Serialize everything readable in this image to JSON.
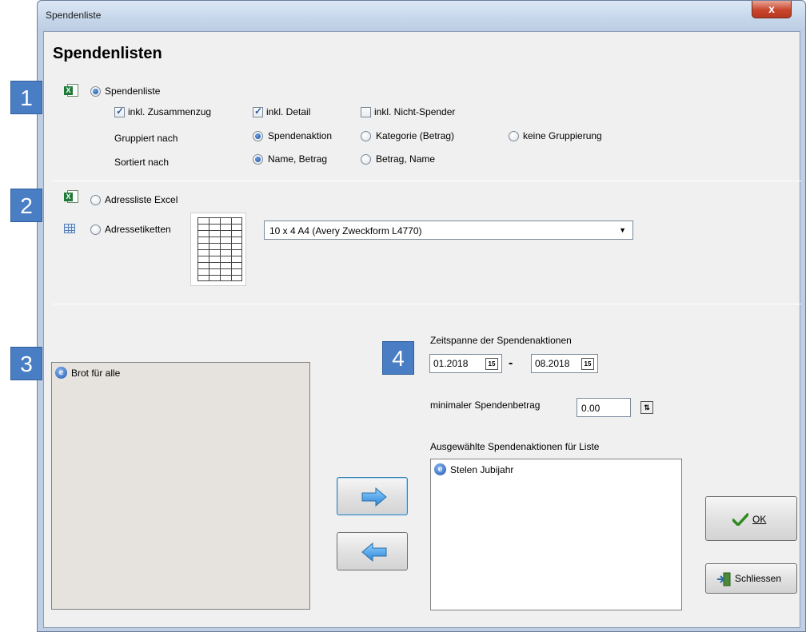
{
  "window": {
    "title": "Spendenliste",
    "close_glyph": "x"
  },
  "heading": "Spendenlisten",
  "badges": [
    "1",
    "2",
    "3",
    "4"
  ],
  "section1": {
    "main_option": "Spendenliste",
    "check_zusammenzug": "inkl. Zusammenzug",
    "check_detail": "inkl. Detail",
    "check_nicht_spender": "inkl. Nicht-Spender",
    "group_label": "Gruppiert nach",
    "group_options": [
      "Spendenaktion",
      "Kategorie (Betrag)",
      "keine Gruppierung"
    ],
    "sort_label": "Sortiert nach",
    "sort_options": [
      "Name, Betrag",
      "Betrag, Name"
    ]
  },
  "section2": {
    "option_excel": "Adressliste Excel",
    "option_etiketten": "Adressetiketten",
    "label_format": "10 x 4  A4 (Avery Zweckform L4770)"
  },
  "available_list": {
    "items": [
      "Brot für alle"
    ]
  },
  "period": {
    "label": "Zeitspanne der Spendenaktionen",
    "from": "01.2018",
    "separator": "-",
    "to": "08.2018",
    "calendar_glyph": "15"
  },
  "min_amount": {
    "label": "minimaler Spendenbetrag",
    "value": "0.00"
  },
  "selected_list": {
    "label": "Ausgewählte Spendenaktionen für Liste",
    "items": [
      "Stelen Jubijahr"
    ]
  },
  "buttons": {
    "ok": "OK",
    "close": "Schliessen"
  },
  "colors": {
    "badge": "#4a7ec4",
    "arrow": "#3a9ae8",
    "ok_check": "#2f8a1f",
    "titlebar": "#c6d6ea"
  },
  "icons": [
    "excel-icon",
    "grid-icon",
    "campaign-icon",
    "calendar-icon",
    "spinner-icon",
    "arrow-right-icon",
    "arrow-left-icon",
    "checkmark-icon",
    "exit-door-icon"
  ]
}
